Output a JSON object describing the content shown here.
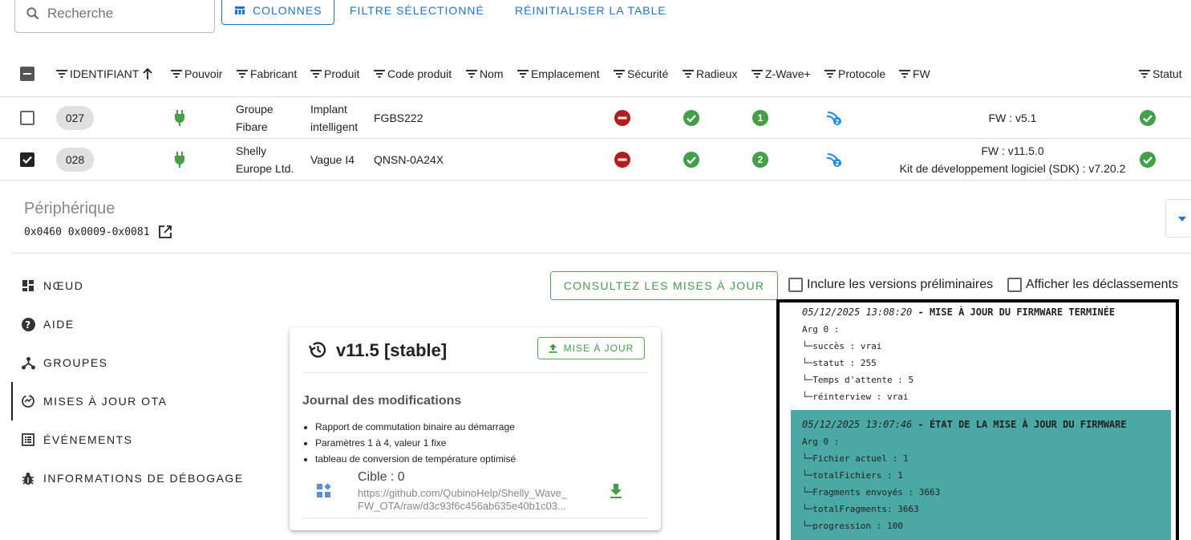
{
  "toolbar": {
    "search_placeholder": "Recherche",
    "columns_label": "COLONNES",
    "filter_label": "FILTRE SÉLECTIONNÉ",
    "reset_label": "RÉINITIALISER LA TABLE"
  },
  "table": {
    "headers": [
      "IDENTIFIANT",
      "Pouvoir",
      "Fabricant",
      "Produit",
      "Code produit",
      "Nom",
      "Emplacement",
      "Sécurité",
      "Radieux",
      "Z-Wave+",
      "Protocole",
      "FW",
      "Statut"
    ],
    "rows": [
      {
        "id": "027",
        "checked": false,
        "manufacturer_line1": "Groupe",
        "manufacturer_line2": "Fibare",
        "product_line1": "Implant",
        "product_line2": "intelligent",
        "product_code": "FGBS222",
        "zwave_plus": "1",
        "fw_line1": "FW : v5.1",
        "fw_line2": ""
      },
      {
        "id": "028",
        "checked": true,
        "manufacturer_line1": "Shelly",
        "manufacturer_line2": "Europe Ltd.",
        "product_line1": "Vague I4",
        "product_line2": "",
        "product_code": "QNSN-0A24X",
        "zwave_plus": "2",
        "fw_line1": "FW : v11.5.0",
        "fw_line2": "Kit de développement logiciel (SDK) : v7.20.2"
      }
    ]
  },
  "device": {
    "title": "Périphérique",
    "id": "0x0460 0x0009-0x0081"
  },
  "nav": {
    "items": [
      {
        "label": "NŒUD",
        "icon": "grid-icon"
      },
      {
        "label": "AIDE",
        "icon": "help-icon"
      },
      {
        "label": "GROUPES",
        "icon": "groups-icon"
      },
      {
        "label": "MISES À JOUR OTA",
        "icon": "ota-icon"
      },
      {
        "label": "ÉVÉNEMENTS",
        "icon": "events-icon"
      },
      {
        "label": "INFORMATIONS DE DÉBOGAGE",
        "icon": "bug-icon"
      }
    ]
  },
  "updates": {
    "check_label": "CONSULTEZ LES MISES À JOUR",
    "include_prerelease": "Inclure les versions préliminaires",
    "show_downgrades": "Afficher les déclassements"
  },
  "card": {
    "version": "v11.5 [stable]",
    "update_label": "MISE À JOUR",
    "changelog_title": "Journal des modifications",
    "changelog": [
      "Rapport de commutation binaire au démarrage",
      "Paramètres 1 à 4, valeur 1 fixe",
      "tableau de conversion de température optimisé"
    ],
    "target": "Cible : 0",
    "url_line1": "https://github.com/QubinoHelp/Shelly_Wave_",
    "url_line2": "FW_OTA/raw/d3c93f6c456ab635e40b1c03..."
  },
  "log": {
    "entries": [
      {
        "time": "05/12/2025 13:08:20",
        "title": " - MISE À JOUR DU FIRMWARE TERMINÉE",
        "lines": [
          "Arg 0 :",
          "└─succès : vrai",
          "└─statut : 255",
          "└─Temps d'attente : 5",
          "└─réinterview : vrai"
        ]
      },
      {
        "time": "05/12/2025 13:07:46",
        "title": " - ÉTAT DE LA MISE À JOUR DU FIRMWARE",
        "lines": [
          "Arg 0 :",
          "└─Fichier actuel : 1",
          "└─totalFichiers : 1",
          "└─Fragments envoyés : 3663",
          "└─totalFragments: 3663",
          "└─progression : 100"
        ]
      }
    ]
  },
  "colors": {
    "primary": "#1976d2",
    "success": "#43a047",
    "danger": "#b71c1c",
    "highlight": "#4aa8a5"
  }
}
